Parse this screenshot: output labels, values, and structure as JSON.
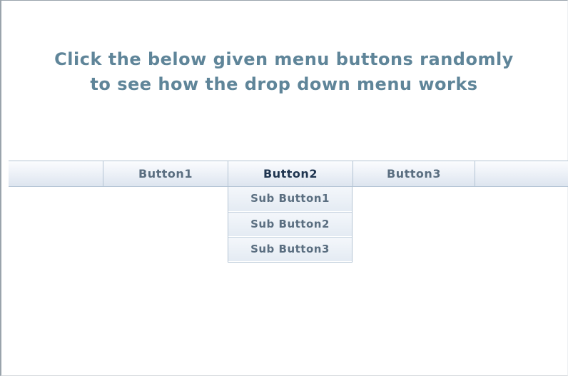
{
  "instructions": {
    "line1": "Click  the below given menu buttons randomly",
    "line2": "to see how the drop down menu works"
  },
  "menu": {
    "buttons": [
      {
        "label": "Button1",
        "active": false
      },
      {
        "label": "Button2",
        "active": true
      },
      {
        "label": "Button3",
        "active": false
      }
    ],
    "dropdown": {
      "items": [
        {
          "label": "Sub Button1"
        },
        {
          "label": "Sub Button2"
        },
        {
          "label": "Sub Button3"
        }
      ]
    }
  },
  "colors": {
    "heading": "#5f8599",
    "menu_text": "#5a6e80",
    "menu_active_text": "#1f3550",
    "menu_border": "#b4c4d4"
  }
}
